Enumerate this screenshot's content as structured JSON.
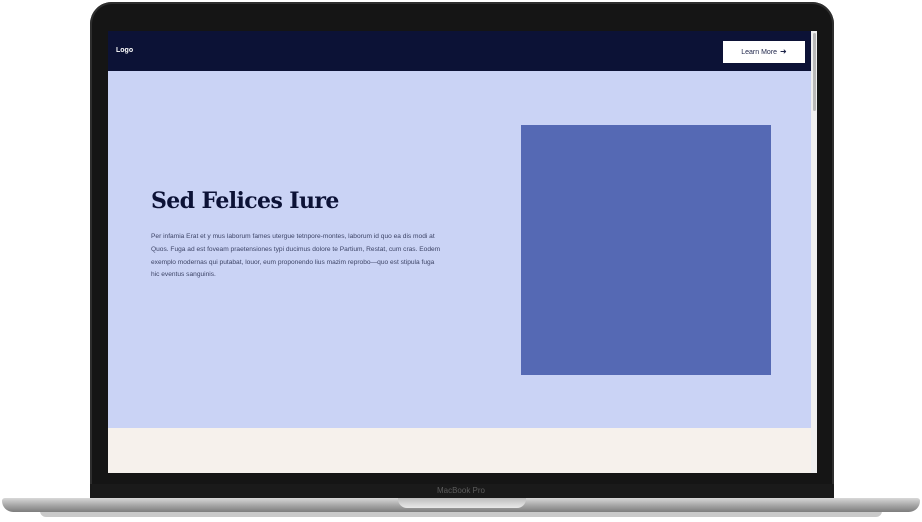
{
  "device": {
    "label": "MacBook Pro"
  },
  "site": {
    "nav": {
      "logo": "Logo",
      "cta_label": "Learn More",
      "cta_icon": "arrow-right-icon"
    },
    "hero": {
      "title": "Sed Felices Iure",
      "body": "Per infamia Erat et y mus laborum fames utergue tetnpore-montes, laborum id quo ea dis modi at Quos. Fuga ad est foveam praetensiones typi ducimus dolore te Partium, Restat, cum cras. Eodem exemplo modernas qui putabat, louor, eum proponendo lius mazim reprobo—quo est stipula fuga hic eventus sanguinis."
    },
    "colors": {
      "nav_bg": "#0c1236",
      "hero_bg": "#cad3f5",
      "image_block": "#5569b4",
      "section_bg": "#f6f1ec"
    }
  }
}
